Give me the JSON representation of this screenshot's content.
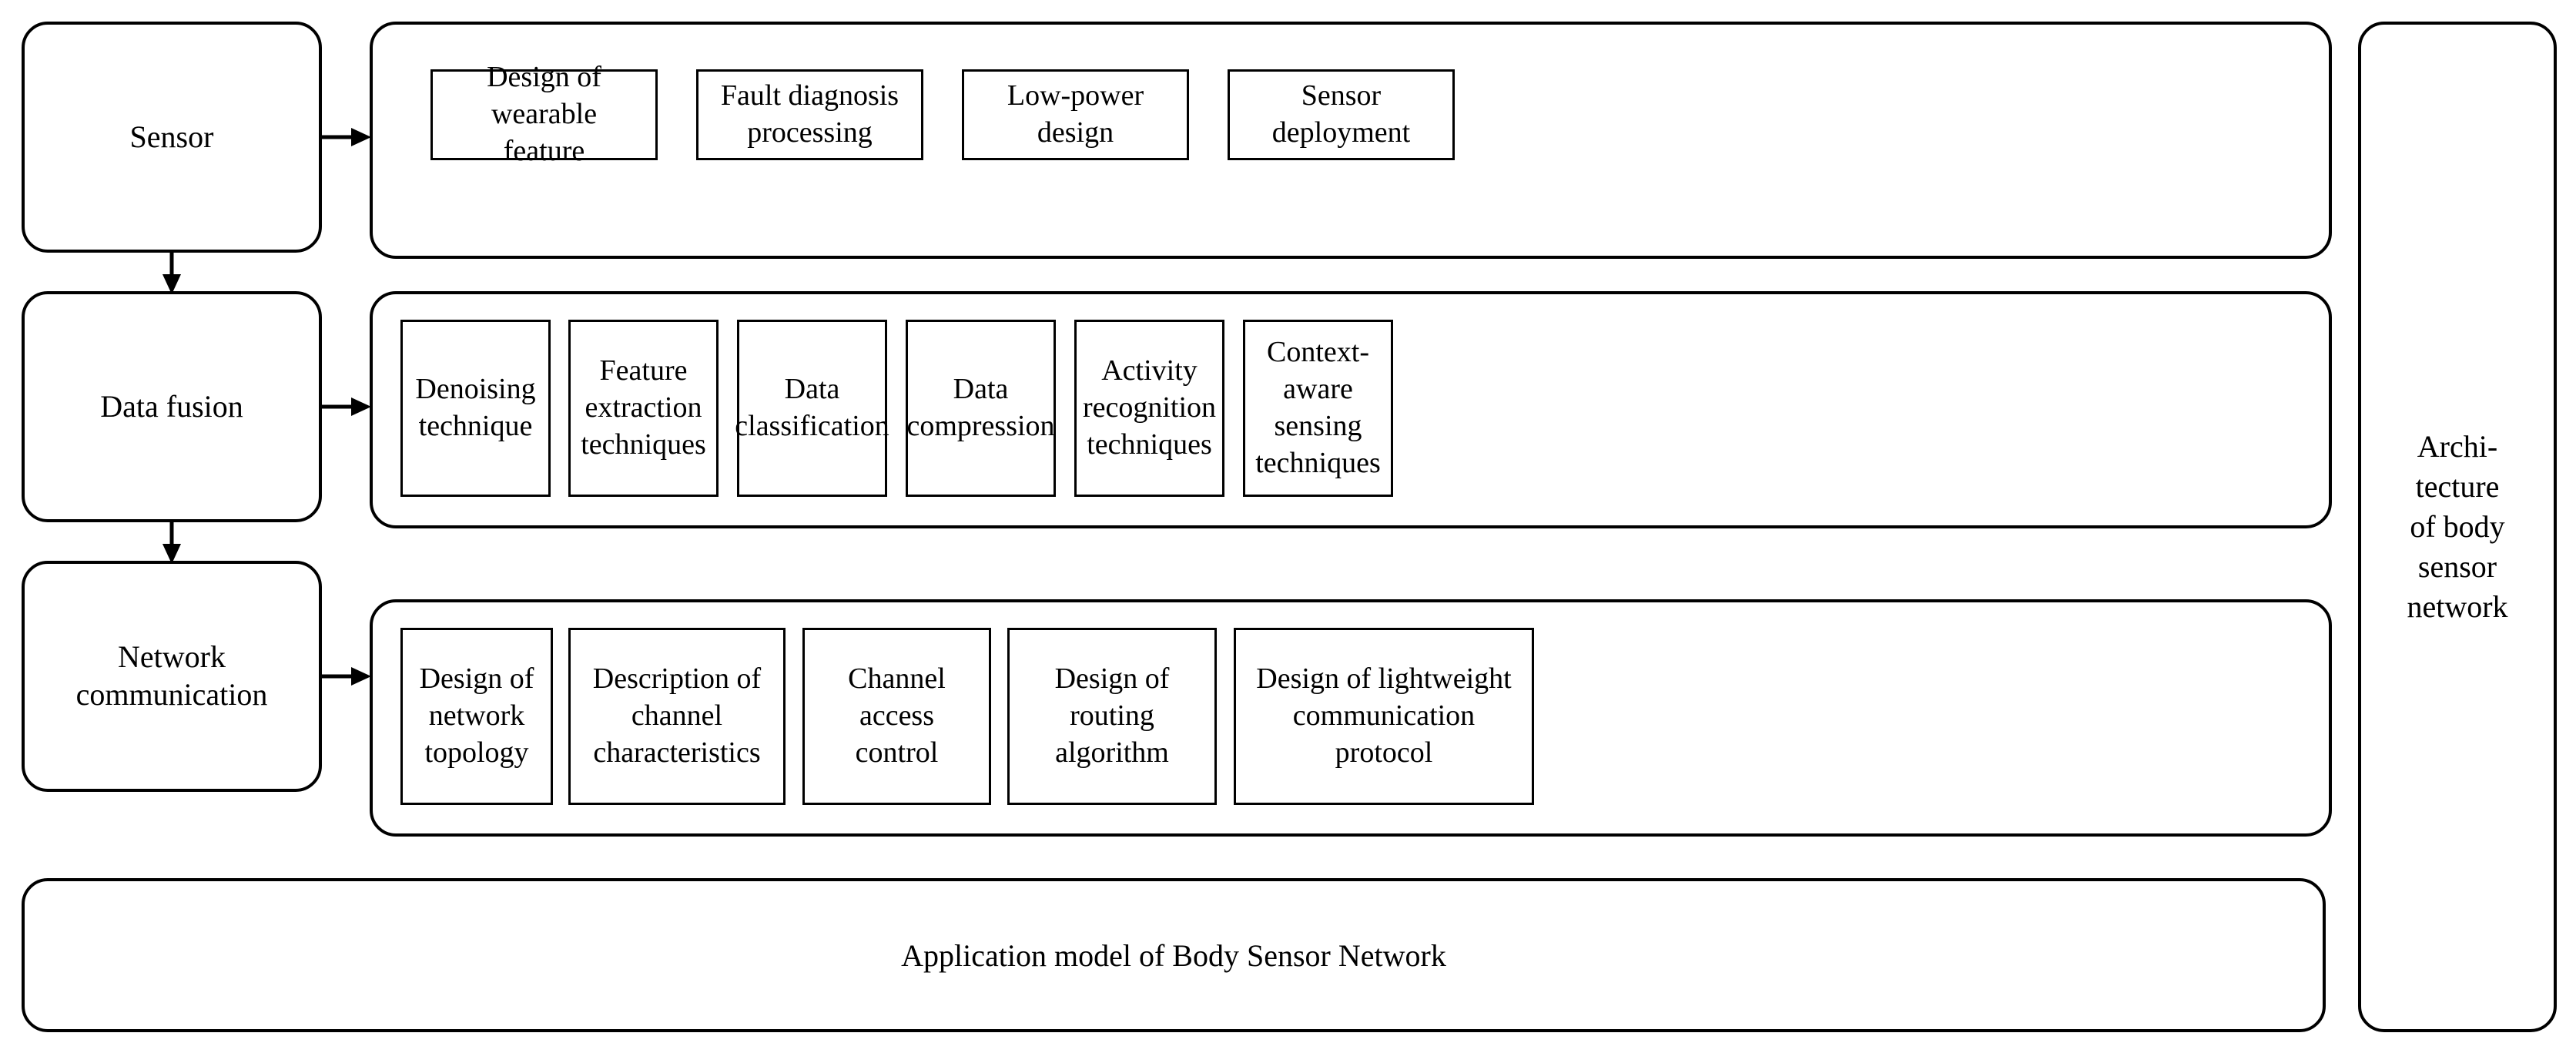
{
  "diagram": {
    "title": "Architecture of body sensor network",
    "stages": [
      {
        "id": "sensor",
        "label": "Sensor"
      },
      {
        "id": "fusion",
        "label": "Data fusion"
      },
      {
        "id": "network",
        "label": "Network\ncommunication"
      }
    ],
    "rows": [
      {
        "id": "sensor-row",
        "items": [
          "Design of wearable\nfeature",
          "Fault diagnosis\nprocessing",
          "Low-power design",
          "Sensor deployment"
        ]
      },
      {
        "id": "fusion-row",
        "items": [
          "Denoising\ntechnique",
          "Feature\nextraction\ntechniques",
          "Data\nclassification",
          "Data\ncompression",
          "Activity\nrecognition\ntechniques",
          "Context-aware\nsensing\ntechniques"
        ]
      },
      {
        "id": "network-row",
        "items": [
          "Design of\nnetwork\ntopology",
          "Description of\nchannel\ncharacteristics",
          "Channel access\ncontrol",
          "Design of routing\nalgorithm",
          "Design of lightweight\ncommunication protocol"
        ]
      }
    ],
    "footer": {
      "label": "Application model of Body Sensor Network"
    },
    "side_column": {
      "label": "Archi-\ntecture\nof body\nsensor\nnetwork"
    },
    "colors": {
      "stroke": "#000000",
      "fill": "#ffffff",
      "text": "#000000"
    }
  }
}
